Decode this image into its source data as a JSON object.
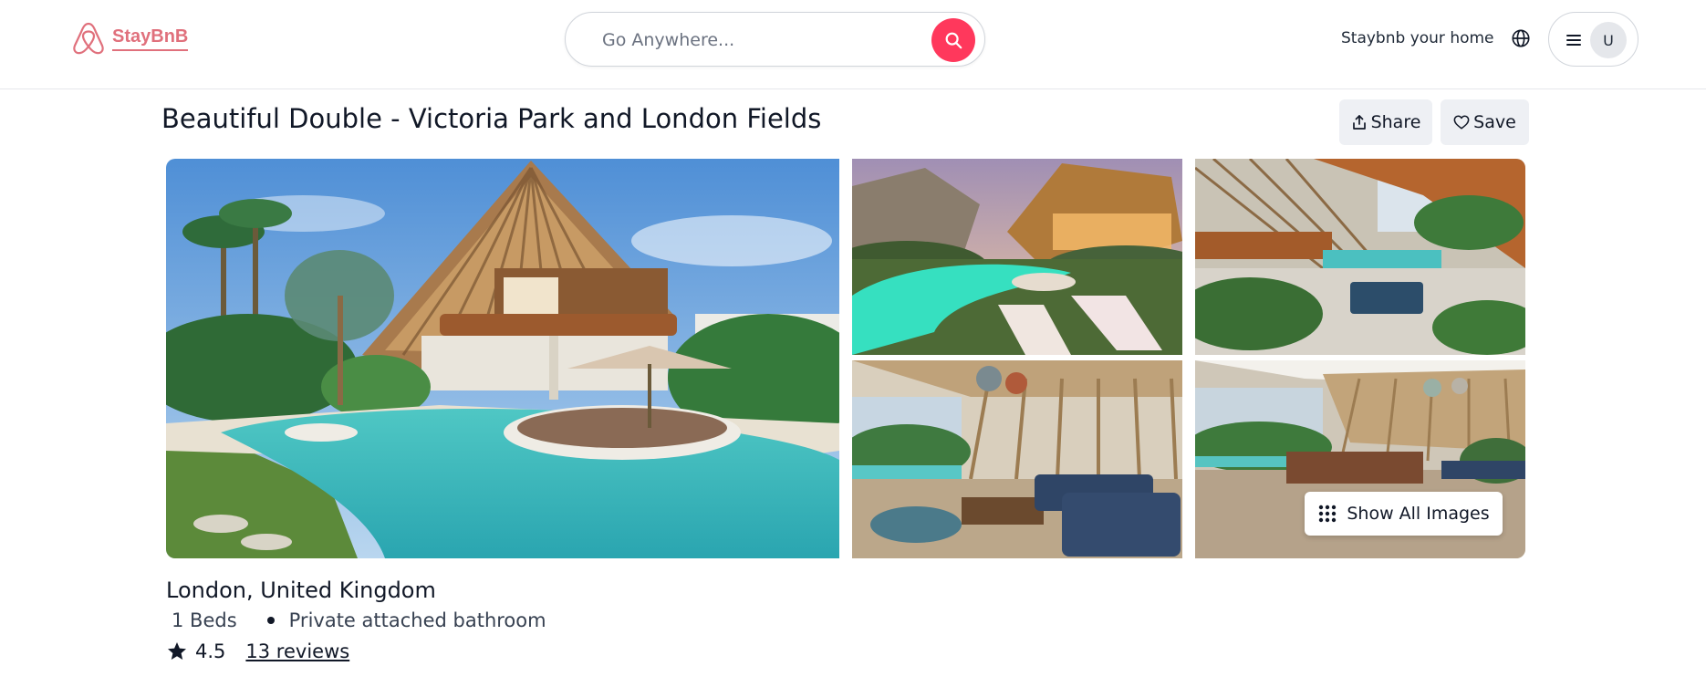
{
  "header": {
    "brand": "StayBnB",
    "search_placeholder": "Go Anywhere...",
    "host_link": "Staybnb your home",
    "avatar_initial": "U"
  },
  "listing": {
    "title": "Beautiful Double - Victoria Park and London Fields",
    "share_label": "Share",
    "save_label": "Save",
    "show_all_label": "Show All Images",
    "location": "London, United Kingdom",
    "features": [
      "1 Beds",
      "Private attached bathroom"
    ],
    "rating": "4.5",
    "reviews_label": "13 reviews"
  },
  "colors": {
    "brand": "#e0707c",
    "search_button": "#ff385c",
    "action_button_bg": "#eef0f4"
  },
  "icons": {
    "logo": "airbnb-logo-icon",
    "search": "search-icon",
    "globe": "globe-icon",
    "menu": "hamburger-icon",
    "share": "share-icon",
    "save": "heart-icon",
    "grid": "grid-dots-icon",
    "rating": "star-icon"
  }
}
